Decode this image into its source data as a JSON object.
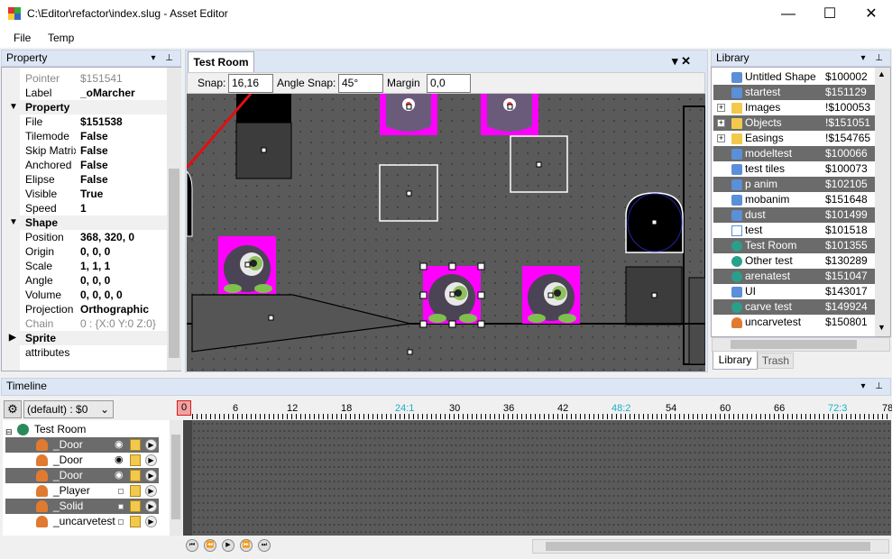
{
  "window": {
    "title": "C:\\Editor\\refactor\\index.slug - Asset Editor",
    "min": "—",
    "max": "☐",
    "close": "✕"
  },
  "menu": [
    {
      "label": "File"
    },
    {
      "label": "Temp"
    }
  ],
  "property_panel": {
    "title": "Property",
    "rows": [
      {
        "key": "Pointer",
        "value": "$151541",
        "kind": "gray"
      },
      {
        "key": "Label",
        "value": "_oMarcher",
        "kind": "bold"
      },
      {
        "key": "Property",
        "kind": "cat",
        "twisty": "▼"
      },
      {
        "key": "File",
        "value": "$151538",
        "kind": "bold"
      },
      {
        "key": "Tilemode",
        "value": "False",
        "kind": "bold"
      },
      {
        "key": "Skip Matrix",
        "value": "False",
        "kind": "bold"
      },
      {
        "key": "Anchored",
        "value": "False",
        "kind": "bold"
      },
      {
        "key": "Elipse",
        "value": "False",
        "kind": "bold"
      },
      {
        "key": "Visible",
        "value": "True",
        "kind": "bold"
      },
      {
        "key": "Speed",
        "value": "1",
        "kind": "bold"
      },
      {
        "key": "Shape",
        "kind": "cat",
        "twisty": "▼"
      },
      {
        "key": "Position",
        "value": "368, 320, 0",
        "kind": "bold"
      },
      {
        "key": "Origin",
        "value": "0, 0, 0",
        "kind": "bold"
      },
      {
        "key": "Scale",
        "value": "1, 1, 1",
        "kind": "bold"
      },
      {
        "key": "Angle",
        "value": "0, 0, 0",
        "kind": "bold"
      },
      {
        "key": "Volume",
        "value": "0, 0, 0, 0",
        "kind": "bold"
      },
      {
        "key": "Projection",
        "value": "Orthographic",
        "kind": "bold"
      },
      {
        "key": "Chain",
        "value": "0 : {X:0 Y:0 Z:0}",
        "kind": "gray"
      },
      {
        "key": "Sprite",
        "kind": "cat",
        "twisty": "▶"
      },
      {
        "key": "attributes",
        "value": "",
        "kind": "plain"
      }
    ]
  },
  "document": {
    "tab": "Test Room",
    "tab_icons": "▾ ✕",
    "toolbar": {
      "snap_label": "Snap:",
      "snap_value": "16,16",
      "angle_label": "Angle Snap:",
      "angle_value": "45°",
      "margin_label": "Margin",
      "margin_value": "0,0"
    }
  },
  "library": {
    "title": "Library",
    "items": [
      {
        "name": "Untitled Shape",
        "id": "$100002",
        "icon": "shape-icon",
        "sel": false,
        "exp": ""
      },
      {
        "name": "startest",
        "id": "$151129",
        "icon": "shape-icon",
        "sel": true,
        "exp": ""
      },
      {
        "name": "Images",
        "id": "!$100053",
        "icon": "folder-icon",
        "sel": false,
        "exp": "+"
      },
      {
        "name": "Objects",
        "id": "!$151051",
        "icon": "folder-icon",
        "sel": true,
        "exp": "+"
      },
      {
        "name": "Easings",
        "id": "!$154765",
        "icon": "folder-icon",
        "sel": false,
        "exp": "+"
      },
      {
        "name": "modeltest",
        "id": "$100066",
        "icon": "shape-icon",
        "sel": true,
        "exp": ""
      },
      {
        "name": "test tiles",
        "id": "$100073",
        "icon": "shape-icon",
        "sel": false,
        "exp": ""
      },
      {
        "name": "p anim",
        "id": "$102105",
        "icon": "shape-icon",
        "sel": true,
        "exp": ""
      },
      {
        "name": "mobanim",
        "id": "$151648",
        "icon": "shape-icon",
        "sel": false,
        "exp": ""
      },
      {
        "name": "dust",
        "id": "$101499",
        "icon": "shape-icon",
        "sel": true,
        "exp": ""
      },
      {
        "name": "test",
        "id": "$101518",
        "icon": "arrow-icon",
        "sel": false,
        "exp": ""
      },
      {
        "name": "Test Room",
        "id": "$101355",
        "icon": "globe-icon",
        "sel": true,
        "exp": ""
      },
      {
        "name": "Other test",
        "id": "$130289",
        "icon": "globe-icon",
        "sel": false,
        "exp": ""
      },
      {
        "name": "arenatest",
        "id": "$151047",
        "icon": "globe-icon",
        "sel": true,
        "exp": ""
      },
      {
        "name": "UI",
        "id": "$143017",
        "icon": "shape-icon",
        "sel": false,
        "exp": ""
      },
      {
        "name": "carve test",
        "id": "$149924",
        "icon": "globe-icon",
        "sel": true,
        "exp": ""
      },
      {
        "name": "uncarvetest",
        "id": "$150801",
        "icon": "person-icon",
        "sel": false,
        "exp": ""
      }
    ],
    "tabs": [
      {
        "label": "Library"
      },
      {
        "label": "Trash"
      }
    ]
  },
  "timeline": {
    "title": "Timeline",
    "track_select": "(default) : $0",
    "frame_marker": "0",
    "ruler": [
      {
        "v": "6",
        "c": "#000"
      },
      {
        "v": "12",
        "c": "#000"
      },
      {
        "v": "18",
        "c": "#000"
      },
      {
        "v": "24:1",
        "c": "#1ab0c8"
      },
      {
        "v": "30",
        "c": "#000"
      },
      {
        "v": "36",
        "c": "#000"
      },
      {
        "v": "42",
        "c": "#000"
      },
      {
        "v": "48:2",
        "c": "#1ab0c8"
      },
      {
        "v": "54",
        "c": "#000"
      },
      {
        "v": "60",
        "c": "#000"
      },
      {
        "v": "66",
        "c": "#000"
      },
      {
        "v": "72:3",
        "c": "#1ab0c8"
      },
      {
        "v": "78",
        "c": "#000"
      }
    ],
    "root": "Test Room",
    "tracks": [
      {
        "name": "_Door",
        "dark": true,
        "eye": true
      },
      {
        "name": "_Door",
        "dark": false,
        "eye": true
      },
      {
        "name": "_Door",
        "dark": true,
        "eye": true
      },
      {
        "name": "_Player",
        "dark": false,
        "eye": false
      },
      {
        "name": "_Solid",
        "dark": true,
        "eye": false
      },
      {
        "name": "_uncarvetest",
        "dark": false,
        "eye": false
      }
    ],
    "transport": [
      "⏮",
      "⏪",
      "▶",
      "⏩",
      "⏭"
    ]
  },
  "colors": {
    "accent": "#dce6f4",
    "selection": "#6b6b6b",
    "magenta": "#ff00ff",
    "canvas": "#5a5a5a"
  }
}
